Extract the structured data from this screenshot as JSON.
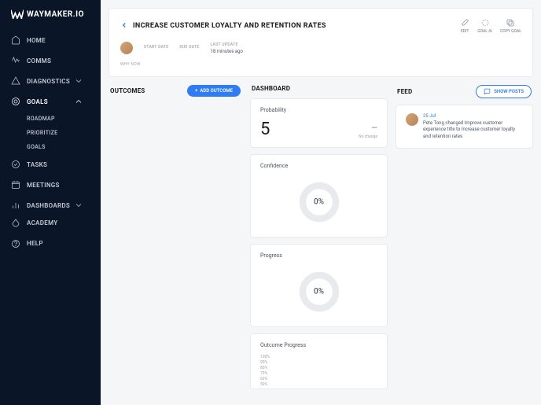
{
  "logo": "WAYMAKER.IO",
  "nav": {
    "main": [
      {
        "label": "HOME",
        "icon": "home"
      },
      {
        "label": "COMMS",
        "icon": "comms"
      },
      {
        "label": "DIAGNOSTICS",
        "icon": "diag",
        "chev": "down"
      },
      {
        "label": "GOALS",
        "icon": "goals",
        "chev": "up",
        "active": true,
        "sub": [
          {
            "label": "ROADMAP"
          },
          {
            "label": "PRIORITIZE"
          },
          {
            "label": "GOALS"
          }
        ]
      },
      {
        "label": "TASKS",
        "icon": "tasks"
      },
      {
        "label": "MEETINGS",
        "icon": "meetings"
      },
      {
        "label": "DASHBOARDS",
        "icon": "dash",
        "chev": "down"
      }
    ],
    "bottom": [
      {
        "label": "ACADEMY",
        "icon": "academy"
      },
      {
        "label": "HELP",
        "icon": "help"
      }
    ]
  },
  "header": {
    "title": "INCREASE CUSTOMER LOYALTY AND RETENTION RATES",
    "actions": [
      {
        "label": "EDIT",
        "icon": "edit"
      },
      {
        "label": "GOAL AI",
        "icon": "ai"
      },
      {
        "label": "COPY GOAL",
        "icon": "copy"
      }
    ],
    "meta": {
      "start": {
        "label": "START DATE",
        "value": ""
      },
      "due": {
        "label": "DUE DATE",
        "value": ""
      },
      "update": {
        "label": "LAST UPDATE",
        "value": "18 minutes ago"
      }
    },
    "whyNow": "WHY NOW"
  },
  "outcomes": {
    "title": "OUTCOMES",
    "addLabel": "ADD OUTCOME"
  },
  "dashboard": {
    "title": "DASHBOARD",
    "probability": {
      "label": "Probability",
      "value": "5",
      "changeSymbol": "—",
      "changeText": "No change"
    },
    "confidence": {
      "label": "Confidence",
      "value": "0%"
    },
    "progress": {
      "label": "Progress",
      "value": "0%"
    },
    "outcomeProgress": {
      "label": "Outcome Progress",
      "axis": [
        "100%",
        "90%",
        "80%",
        "70%",
        "60%",
        "50%"
      ]
    }
  },
  "feed": {
    "title": "FEED",
    "showLabel": "SHOW POSTS",
    "items": [
      {
        "date": "25 Jul",
        "text": "Pete Tong changed Improve customer experience title to Increase customer loyalty and retention rates"
      }
    ]
  }
}
